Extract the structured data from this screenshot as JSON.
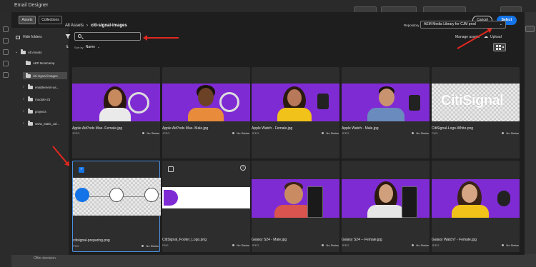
{
  "app": {
    "title": "Email Designer",
    "bottom_field": "Offer decision"
  },
  "modal": {
    "tabs": [
      {
        "label": "Assets",
        "active": true
      },
      {
        "label": "Collections",
        "active": false
      }
    ],
    "cancel_label": "Cancel",
    "select_label": "Select",
    "hide_folders_label": "Hide folders"
  },
  "sidebar": {
    "items": [
      {
        "label": "All Assets",
        "level": 0,
        "expanded": true
      },
      {
        "label": "AEP Bootcamp",
        "level": 1
      },
      {
        "label": "citi-signal-images",
        "level": 1,
        "selected": true
      },
      {
        "label": "enablement-as...",
        "level": 1
      },
      {
        "label": "module-23",
        "level": 1
      },
      {
        "label": "projects",
        "level": 1
      },
      {
        "label": "www_static_ad...",
        "level": 1
      }
    ]
  },
  "breadcrumb": {
    "root": "All Assets",
    "separator": "›",
    "current": "citi-signal-images"
  },
  "repository": {
    "label": "Repository",
    "value": "AEM Media Library for CJM prod"
  },
  "toolbar": {
    "manage_label": "Manage assets",
    "upload_label": "Upload",
    "sort_prefix": "Sort by",
    "sort_value": "Name"
  },
  "status_label": "No Status",
  "assets": [
    {
      "name": "Apple AirPods Max- Female.jpg",
      "type": "JPEG",
      "status": "No Status"
    },
    {
      "name": "Apple AirPods Max- Male.jpg",
      "type": "JPEG",
      "status": "No Status"
    },
    {
      "name": "Apple Watch - Female.jpg",
      "type": "JPEG",
      "status": "No Status"
    },
    {
      "name": "Apple Watch - Male.jpg",
      "type": "JPEG",
      "status": "No Status"
    },
    {
      "name": "CitiSignal-Logo-White.png",
      "type": "PNG",
      "status": "No Status",
      "logo_text": "CitiSignal"
    },
    {
      "name": "citisignal-preparing.png",
      "type": "PNG",
      "status": "No Status",
      "checked": true
    },
    {
      "name": "CitiSignal_Footer_Logo.png",
      "type": "PNG",
      "status": "No Status"
    },
    {
      "name": "Galaxy S24 - Male.jpg",
      "type": "JPEG",
      "status": "No Status"
    },
    {
      "name": "Galaxy S24 -- Female.jpg",
      "type": "JPEG",
      "status": "No Status"
    },
    {
      "name": "Galaxy Watch7 - Female.jpg",
      "type": "JPEG",
      "status": "No Status"
    }
  ],
  "colors": {
    "accent": "#1473e6",
    "brand_purple": "#7f2bd4",
    "annotation_arrow": "#e0281f"
  }
}
